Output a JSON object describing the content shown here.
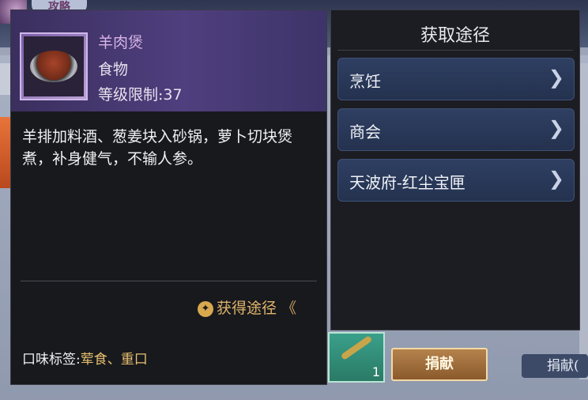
{
  "background": {
    "gonglue_label": "攻略",
    "slot_count": "1",
    "donate_label": "捐献",
    "donate2_label": "捐献("
  },
  "item": {
    "name": "羊肉煲",
    "type": "食物",
    "level_label": "等级限制",
    "level_value": "37",
    "description": "羊排加料酒、葱姜块入砂锅，萝卜切块煲煮，补身健气，不输人参。",
    "obtain_label": "获得途径",
    "obtain_chevron": "《",
    "tag_label": "口味标签:",
    "tag_values": "荤食、重口",
    "colors": {
      "name": "#d6b3e6",
      "accent": "#e0b56a"
    }
  },
  "ways": {
    "title": "获取途径",
    "items": [
      {
        "label": "烹饪",
        "arrow": "❯"
      },
      {
        "label": "商会",
        "arrow": "❯"
      },
      {
        "label": "天波府-红尘宝匣",
        "arrow": "❯"
      }
    ]
  }
}
